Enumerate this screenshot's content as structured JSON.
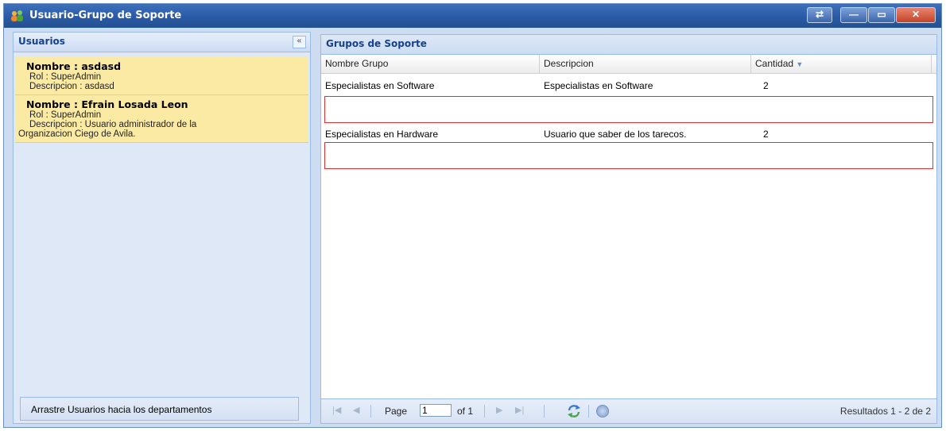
{
  "window": {
    "title": "Usuario-Grupo de Soporte"
  },
  "left_panel": {
    "title": "Usuarios",
    "collapse_glyph": "«",
    "users": [
      {
        "name": "Nombre : asdasd",
        "rol": "Rol : SuperAdmin",
        "descripcion": "Descripcion : asdasd"
      },
      {
        "name": "Nombre : Efrain Losada Leon",
        "rol": "Rol : SuperAdmin",
        "descripcion": "Descripcion : Usuario administrador de la",
        "descripcion_cont": "Organizacion Ciego de Avila."
      }
    ],
    "footer_button": "Arrastre Usuarios hacia los departamentos"
  },
  "grid": {
    "title": "Grupos de Soporte",
    "columns": [
      "Nombre Grupo",
      "Descripcion",
      "Cantidad"
    ],
    "rows": [
      {
        "nombre": "Especialistas en Software",
        "descripcion": "Especialistas en Software",
        "cantidad": "2"
      },
      {
        "nombre": "Especialistas en Hardware",
        "descripcion": "Usuario que saber de los tarecos.",
        "cantidad": "2"
      }
    ]
  },
  "pager": {
    "page_label": "Page",
    "page_value": "1",
    "of_label": "of 1",
    "results": "Resultados 1 - 2 de 2"
  },
  "icons": {
    "title": "users-group-icon",
    "first": "first-page-icon",
    "prev": "prev-page-icon",
    "next": "next-page-icon",
    "last": "last-page-icon",
    "refresh": "refresh-icon",
    "help": "help-icon"
  },
  "colors": {
    "title_bar": "#2a5aa6",
    "selected_user": "#fbeaa4",
    "header_text": "#15428b",
    "drop_box_border": "#dd3333"
  }
}
